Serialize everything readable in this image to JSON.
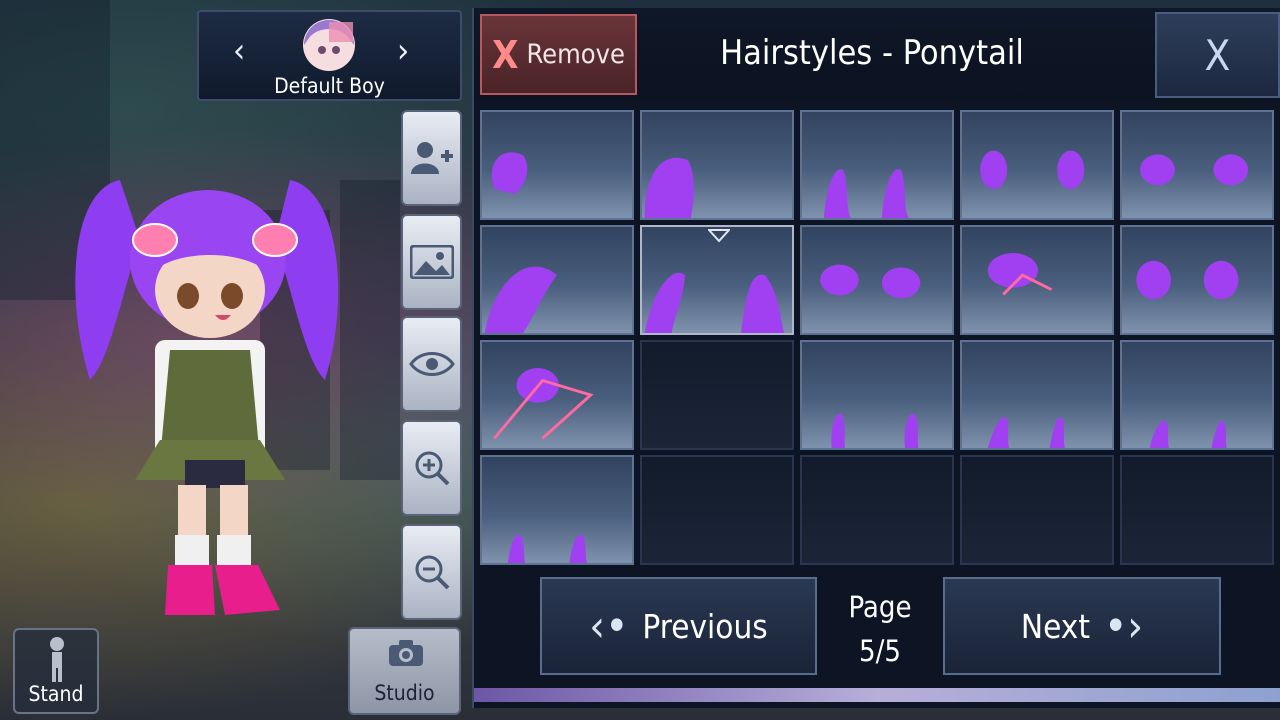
{
  "character_selector": {
    "name": "Default Boy",
    "prev_icon": "chevron-left-icon",
    "next_icon": "chevron-right-icon"
  },
  "side_tools": [
    {
      "name": "add-character-button",
      "icon": "add-person-icon"
    },
    {
      "name": "background-button",
      "icon": "image-icon"
    },
    {
      "name": "visibility-button",
      "icon": "eye-icon"
    },
    {
      "name": "zoom-in-button",
      "icon": "zoom-in-icon"
    },
    {
      "name": "zoom-out-button",
      "icon": "zoom-out-icon"
    }
  ],
  "stand_button": {
    "label": "Stand"
  },
  "studio_button": {
    "label": "Studio"
  },
  "header": {
    "remove_x": "X",
    "remove_label": "Remove",
    "title": "Hairstyles - Ponytail",
    "close_label": "X"
  },
  "grid": {
    "selected_index": 6,
    "items": [
      "ponytail-item",
      "ponytail-item",
      "ponytail-item",
      "ponytail-item",
      "ponytail-item",
      "ponytail-item",
      "ponytail-item",
      "ponytail-item",
      "ponytail-item",
      "ponytail-item",
      "ponytail-item",
      "empty",
      "ponytail-item",
      "ponytail-item",
      "ponytail-item",
      "ponytail-item",
      "empty",
      "empty",
      "empty",
      "empty"
    ]
  },
  "footer": {
    "previous_label": "Previous",
    "next_label": "Next",
    "page_label": "Page",
    "page_value": "5/5"
  },
  "colors": {
    "hair": "#a040f0",
    "panel": "#0d1424",
    "remove_border": "#b7585e"
  }
}
